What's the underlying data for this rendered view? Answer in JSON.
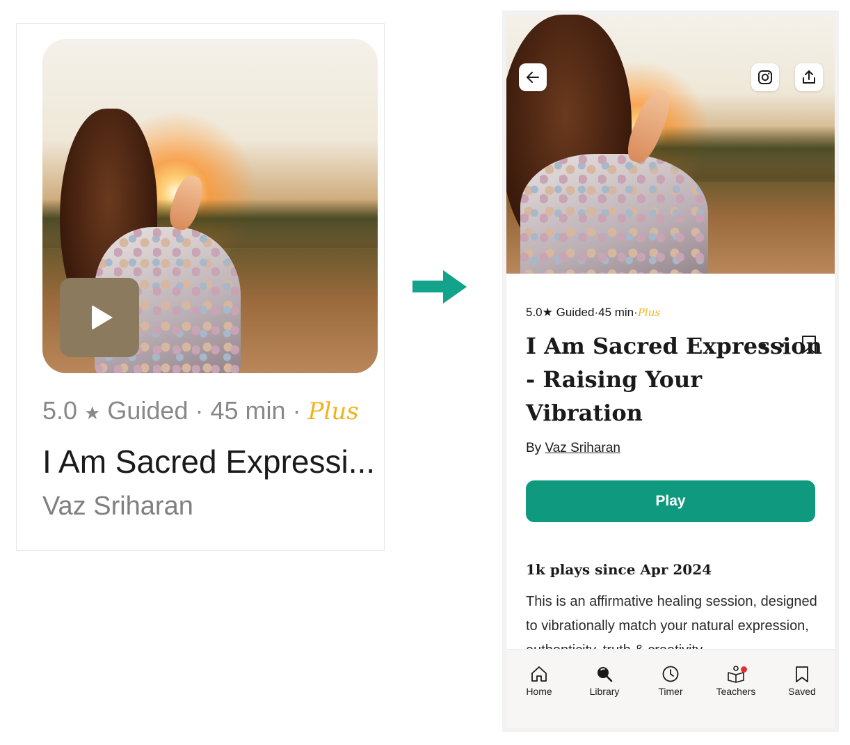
{
  "card": {
    "rating": "5.0",
    "star": "★",
    "type": "Guided",
    "sep1": "·",
    "duration": "45 min",
    "sep2": "·",
    "plus_label": "Plus",
    "title": "I Am Sacred Expressi...",
    "author": "Vaz Sriharan"
  },
  "detail": {
    "meta_rating": "5.0★",
    "meta_type": "Guided",
    "meta_sep1": "·",
    "meta_duration": "45 min",
    "meta_sep2": "·",
    "plus_label": "Plus",
    "title": "I Am Sacred Expression - Raising Your Vibration",
    "author_prefix": "By",
    "author_name": "Vaz Sriharan",
    "play_label": "Play",
    "plays_heading": "1k plays since Apr 2024",
    "description": "This is an affirmative healing session, designed to vibrationally match your natural expression, authenticity, truth & creativity."
  },
  "tabbar": {
    "items": [
      {
        "label": "Home",
        "icon": "home-icon"
      },
      {
        "label": "Library",
        "icon": "library-icon"
      },
      {
        "label": "Timer",
        "icon": "timer-icon"
      },
      {
        "label": "Teachers",
        "icon": "teachers-icon"
      },
      {
        "label": "Saved",
        "icon": "saved-icon"
      }
    ]
  },
  "colors": {
    "accent_green": "#0f9a80",
    "arrow_green": "#12a38a",
    "plus_gold": "#f2b01e",
    "badge_red": "#e03030"
  }
}
